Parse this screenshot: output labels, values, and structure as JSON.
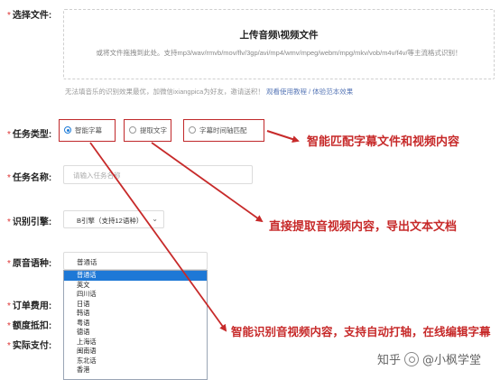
{
  "upload": {
    "label": "选择文件:",
    "title": "上传音频\\视频文件",
    "description": "或将文件拖拽到此处。支持mp3/wav/rmvb/mov/flv/3gp/avi/mp4/wmv/mpeg/webm/mpg/mkv/vob/m4v/f4v/等主流格式识别！",
    "hint_text": "无法填音乐的识别效果最优，加微信ixiangpica为好友，邀请送积！",
    "hint_link": "观看使用教程 / 体验范本效果"
  },
  "task_type": {
    "label": "任务类型:",
    "options": [
      {
        "label": "智能字幕",
        "selected": true
      },
      {
        "label": "提取文字",
        "selected": false
      },
      {
        "label": "字幕时间轴匹配",
        "selected": false
      }
    ]
  },
  "task_name": {
    "label": "任务名称:",
    "placeholder": "请输入任务名称"
  },
  "engine": {
    "label": "识别引擎:",
    "value": "B引擎（支持12语种）",
    "chevron": "chevron-down-icon"
  },
  "language": {
    "label": "原音语种:",
    "value": "普通话",
    "options": [
      "普通话",
      "英文",
      "四川话",
      "日语",
      "韩语",
      "粤语",
      "德语",
      "上海话",
      "闽南语",
      "东北话",
      "香港"
    ]
  },
  "other_labels": {
    "order_fee": "订单费用:",
    "quota": "额度抵扣:",
    "actual_pay": "实际支付:"
  },
  "callouts": {
    "subtitle_match": "智能匹配字幕文件和视频内容",
    "extract_text": "直接提取音视频内容，导出文本文档",
    "smart_subtitle": "智能识别音视频内容，支持自动打轴，在线编辑字幕"
  },
  "watermark": {
    "site": "知乎",
    "author": "@小枫学堂"
  },
  "colors": {
    "annotation_red": "#c72a2a",
    "selection_blue": "#1e78d6"
  }
}
